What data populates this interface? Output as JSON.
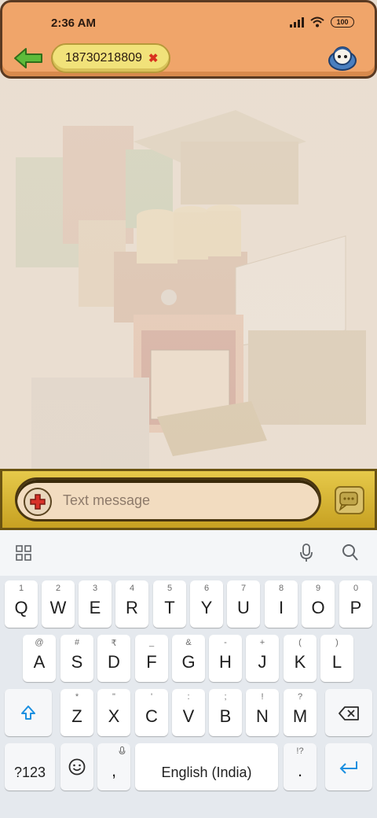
{
  "status_bar": {
    "time": "2:36 AM",
    "battery": "100"
  },
  "header": {
    "contact_number": "18730218809"
  },
  "compose": {
    "placeholder": "Text message"
  },
  "keyboard": {
    "row1": [
      {
        "label": "Q",
        "hint": "1"
      },
      {
        "label": "W",
        "hint": "2"
      },
      {
        "label": "E",
        "hint": "3"
      },
      {
        "label": "R",
        "hint": "4"
      },
      {
        "label": "T",
        "hint": "5"
      },
      {
        "label": "Y",
        "hint": "6"
      },
      {
        "label": "U",
        "hint": "7"
      },
      {
        "label": "I",
        "hint": "8"
      },
      {
        "label": "O",
        "hint": "9"
      },
      {
        "label": "P",
        "hint": "0"
      }
    ],
    "row2": [
      {
        "label": "A",
        "hint": "@"
      },
      {
        "label": "S",
        "hint": "#"
      },
      {
        "label": "D",
        "hint": "₹"
      },
      {
        "label": "F",
        "hint": "_"
      },
      {
        "label": "G",
        "hint": "&"
      },
      {
        "label": "H",
        "hint": "-"
      },
      {
        "label": "J",
        "hint": "+"
      },
      {
        "label": "K",
        "hint": "("
      },
      {
        "label": "L",
        "hint": ")"
      }
    ],
    "row3": [
      {
        "label": "Z",
        "hint": "*"
      },
      {
        "label": "X",
        "hint": "\""
      },
      {
        "label": "C",
        "hint": "'"
      },
      {
        "label": "V",
        "hint": ":"
      },
      {
        "label": "B",
        "hint": ";"
      },
      {
        "label": "N",
        "hint": "!"
      },
      {
        "label": "M",
        "hint": "?"
      }
    ],
    "symbols_label": "?123",
    "comma_label": ",",
    "space_label": "English (India)",
    "period_label": ".",
    "period_hint": "!?"
  }
}
